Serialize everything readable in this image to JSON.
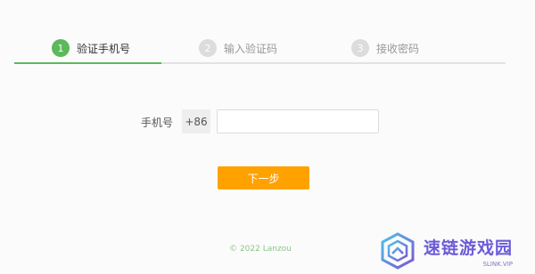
{
  "steps": [
    {
      "num": "1",
      "label": "验证手机号",
      "active": true
    },
    {
      "num": "2",
      "label": "输入验证码",
      "active": false
    },
    {
      "num": "3",
      "label": "接收密码",
      "active": false
    }
  ],
  "form": {
    "phone_label": "手机号",
    "country_code": "+86",
    "phone_value": "",
    "phone_placeholder": ""
  },
  "next_button_label": "下一步",
  "footer_text": "© 2022 Lanzou",
  "watermark": {
    "title": "速链游戏园",
    "url": "SLINK.VIP"
  },
  "colors": {
    "active_step": "#5cb85c",
    "inactive_step": "#dcdcdc",
    "button": "#ffa200",
    "footer": "#8bc48b",
    "watermark": "#6b5bd8"
  }
}
